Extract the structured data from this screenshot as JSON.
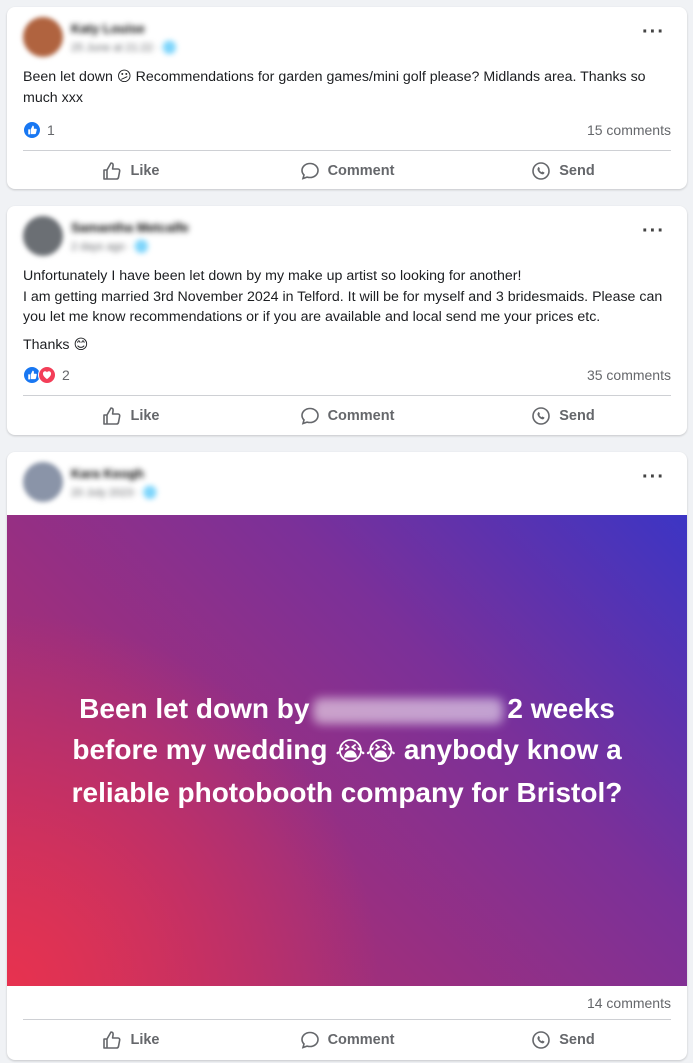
{
  "colors": {
    "like_blue": "#1877f2",
    "love_red": "#f33e58",
    "secondary_text": "#65676b",
    "banner_start": "#e7324f",
    "banner_end": "#3c35c4"
  },
  "actions": {
    "like": "Like",
    "comment": "Comment",
    "send": "Send"
  },
  "posts": [
    {
      "author": "Katy Louise",
      "meta": "25 June at 21:22 · 🌐",
      "avatar_color": "#b0633f",
      "text": "Been let down 😕 Recommendations for garden games/mini golf please? Midlands area. Thanks so much xxx",
      "reactions": [
        "like"
      ],
      "reaction_count": "1",
      "comments": "15 comments"
    },
    {
      "author": "Samantha Metcalfe",
      "meta": "2 days ago · 🌐",
      "avatar_color": "#6b6f74",
      "lines": [
        "Unfortunately I have been let down by my make up artist so looking for another!",
        "I am getting married 3rd November 2024 in Telford. It will be for myself and 3 bridesmaids. Please can you let me know recommendations or if you are available and local send me your prices etc."
      ],
      "thanks": "Thanks 😊",
      "reactions": [
        "like",
        "love"
      ],
      "reaction_count": "2",
      "comments": "35 comments"
    },
    {
      "author": "Kara Keogh",
      "meta": "20 July 2023 · 🌐",
      "avatar_color": "#8a94a8",
      "banner_text_1": "Been let down by",
      "banner_text_2": "2 weeks before my wedding",
      "banner_emoji": "😭😭",
      "banner_text_3": "anybody know a reliable photobooth company for Bristol?",
      "comments": "14 comments"
    }
  ]
}
